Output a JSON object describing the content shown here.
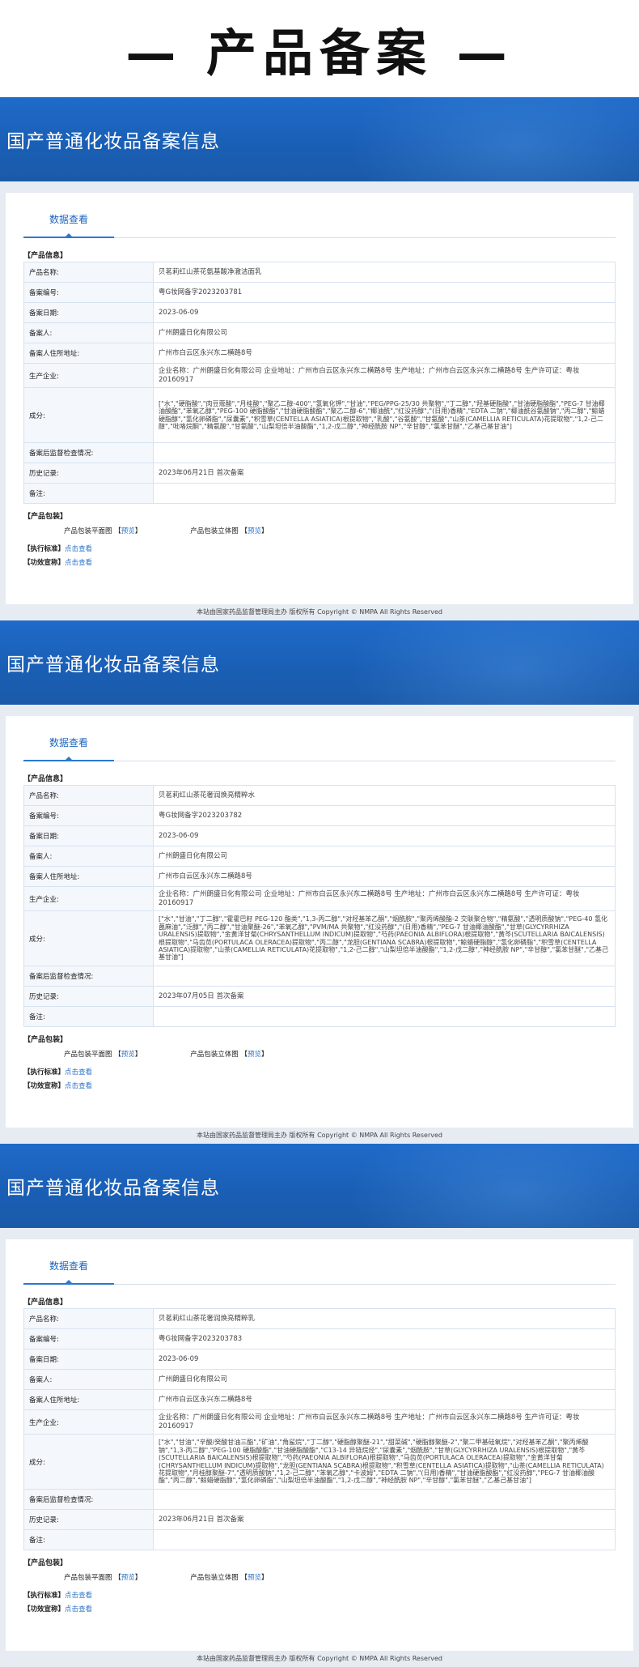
{
  "page_title": "— 产品备案 —",
  "banner_title": "国产普通化妆品备案信息",
  "tab_label": "数据查看",
  "labels": {
    "product_info": "【产品信息】",
    "product_name": "产品名称:",
    "record_no": "备案编号:",
    "record_date": "备案日期:",
    "registrant": "备案人:",
    "registrant_address": "备案人住所地址:",
    "manufacturer": "生产企业:",
    "ingredients": "成分:",
    "post_inspection": "备案后监督检查情况:",
    "history": "历史记录:",
    "remark": "备注:",
    "packaging": "【产品包装】",
    "pkg_flat": "产品包装平面图",
    "pkg_3d": "产品包装立体图",
    "preview": "预览",
    "bracket_open": "【",
    "bracket_close": "】",
    "exec_std": "【执行标准】",
    "efficacy": "【功效宣称】",
    "click_view": "点击查看"
  },
  "footer": "本站由国家药品监督管理局主办 版权所有 Copyright © NMPA All Rights Reserved",
  "records": [
    {
      "product_name": "贝茗莉红山茶花氨基酸净澈洁面乳",
      "record_no": "粤G妆网备字2023203781",
      "record_date": "2023-06-09",
      "registrant": "广州朗盛日化有限公司",
      "registrant_address": "广州市白云区永兴东二横路8号",
      "manufacturer": "企业名称：广州朗盛日化有限公司 企业地址：广州市白云区永兴东二横路8号 生产地址：广州市白云区永兴东二横路8号 生产许可证：粤妆20160917",
      "ingredients": "[\"水\",\"硬脂酸\",\"肉豆蔻酸\",\"月桂酸\",\"聚乙二醇-400\",\"氢氧化钾\",\"甘油\",\"PEG/PPG-25/30 共聚物\",\"丁二醇\",\"羟基硬脂酸\",\"甘油硬脂酸酯\",\"PEG-7 甘油椰油酸酯\",\"苯氧乙醇\",\"PEG-100 硬脂酸酯\",\"甘油硬脂酸酯\",\"聚乙二醇-6\",\"椰油酰\",\"红没药醇\",\"(日用)香精\",\"EDTA 二钠\",\"椰油酰谷氨酸钠\",\"丙二醇\",\"鲸蜡硬脂醇\",\"氢化卵磷脂\",\"尿囊素\",\"积雪草(CENTELLA ASIATICA)根提取物\",\"乳酸\",\"谷氨酸\",\"甘氨酸\",\"山茶(CAMELLIA RETICULATA)花提取物\",\"1,2-己二醇\",\"吡咯烷酮\",\"精氨酸\",\"甘氨酸\",\"山梨坦倍半油酸酯\",\"1,2-戊二醇\",\"神经酰胺 NP\",\"辛甘醇\",\"氯苯甘醚\",\"乙基己基甘油\"]",
      "post_inspection": "",
      "history": "2023年06月21日 首次备案",
      "remark": ""
    },
    {
      "product_name": "贝茗莉红山茶花奢润焕亮精粹水",
      "record_no": "粤G妆网备字2023203782",
      "record_date": "2023-06-09",
      "registrant": "广州朗盛日化有限公司",
      "registrant_address": "广州市白云区永兴东二横路8号",
      "manufacturer": "企业名称：广州朗盛日化有限公司 企业地址：广州市白云区永兴东二横路8号 生产地址：广州市白云区永兴东二横路8号 生产许可证：粤妆20160917",
      "ingredients": "[\"水\",\"甘油\",\"丁二醇\",\"霍霍巴籽 PEG-120 酯类\",\"1,3-丙二醇\",\"对羟基苯乙酮\",\"烟酰胺\",\"聚丙烯酸酯-2 交联聚合物\",\"精氨酸\",\"透明质酸钠\",\"PEG-40 氢化蓖麻油\",\"泛醇\",\"丙二醇\",\"甘油聚醚-26\",\"苯氧乙醇\",\"PVM/MA 共聚物\",\"红没药醇\",\"(日用)香精\",\"PEG-7 甘油椰油酸酯\",\"甘草(GLYCYRRHIZA URALENSIS)提取物\",\"金黄洋甘菊(CHRYSANTHELLUM INDICUM)提取物\",\"芍药(PAEONIA ALBIFLORA)根提取物\",\"黄芩(SCUTELLARIA BAICALENSIS)根提取物\",\"马齿苋(PORTULACA OLERACEA)提取物\",\"丙二醇\",\"龙胆(GENTIANA SCABRA)根提取物\",\"鲸蜡硬脂醇\",\"氢化卵磷脂\",\"积雪草(CENTELLA ASIATICA)提取物\",\"山茶(CAMELLIA RETICULATA)花提取物\",\"1,2-己二醇\",\"山梨坦倍半油酸酯\",\"1,2-戊二醇\",\"神经酰胺 NP\",\"辛甘醇\",\"氯苯甘醚\",\"乙基己基甘油\"]",
      "post_inspection": "",
      "history": "2023年07月05日 首次备案",
      "remark": ""
    },
    {
      "product_name": "贝茗莉红山茶花奢润焕亮精粹乳",
      "record_no": "粤G妆网备字2023203783",
      "record_date": "2023-06-09",
      "registrant": "广州朗盛日化有限公司",
      "registrant_address": "广州市白云区永兴东二横路8号",
      "manufacturer": "企业名称：广州朗盛日化有限公司 企业地址：广州市白云区永兴东二横路8号 生产地址：广州市白云区永兴东二横路8号 生产许可证：粤妆20160917",
      "ingredients": "[\"水\",\"甘油\",\"辛酸/癸酸甘油三酯\",\"矿油\",\"角鲨烷\",\"丁二醇\",\"硬脂醇聚醚-21\",\"甜菜碱\",\"硬脂醇聚醚-2\",\"聚二甲基硅氧烷\",\"对羟基苯乙酮\",\"聚丙烯酸钠\",\"1,3-丙二醇\",\"PEG-100 硬脂酸酯\",\"甘油硬脂酸酯\",\"C13-14 异链烷烃\",\"尿囊素\",\"烟酰胺\",\"甘草(GLYCYRRHIZA URALENSIS)根提取物\",\"黄芩(SCUTELLARIA BAICALENSIS)根提取物\",\"芍药(PAEONIA ALBIFLORA)根提取物\",\"马齿苋(PORTULACA OLERACEA)提取物\",\"金黄洋甘菊(CHRYSANTHELLUM INDICUM)提取物\",\"龙胆(GENTIANA SCABRA)根提取物\",\"积雪草(CENTELLA ASIATICA)提取物\",\"山茶(CAMELLIA RETICULATA)花提取物\",\"月桂醇聚醚-7\",\"透明质酸钠\",\"1,2-己二醇\",\"苯氧乙醇\",\"卡波姆\",\"EDTA 二钠\",\"(日用)香精\",\"甘油硬脂酸酯\",\"红没药醇\",\"PEG-7 甘油椰油酸酯\",\"丙二醇\",\"鲸蜡硬脂醇\",\"氢化卵磷脂\",\"山梨坦倍半油酸酯\",\"1,2-戊二醇\",\"神经酰胺 NP\",\"辛甘醇\",\"氯苯甘醚\",\"乙基己基甘油\"]",
      "post_inspection": "",
      "history": "2023年06月21日 首次备案",
      "remark": ""
    }
  ]
}
